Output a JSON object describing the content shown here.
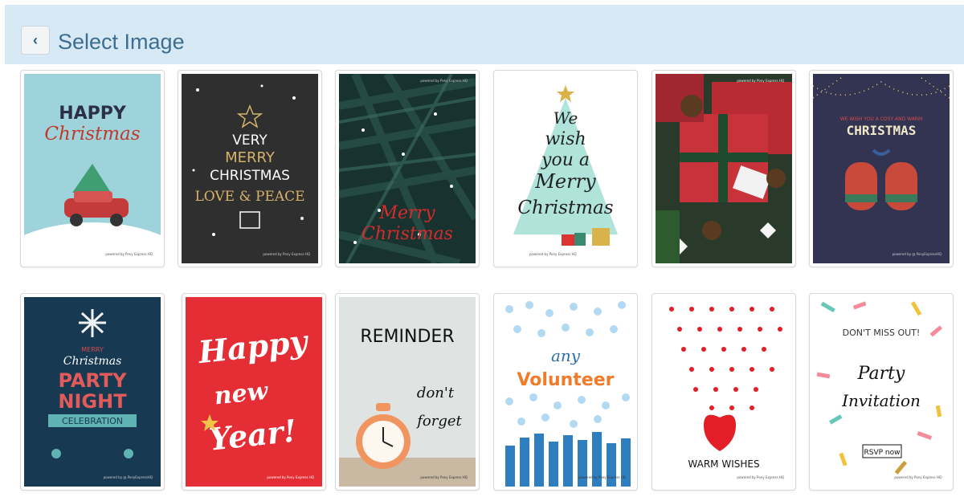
{
  "header": {
    "title": "Select Image",
    "back_icon": "chevron-left-icon"
  },
  "cards": [
    {
      "name": "happy-christmas-car",
      "lines": [
        "HAPPY",
        "Christmas"
      ],
      "footer": "powered by Pony Express HQ"
    },
    {
      "name": "very-merry-christmas",
      "lines": [
        "VERY",
        "MERRY",
        "CHRISTMAS",
        "LOVE & PEACE"
      ],
      "footer": "powered by Pony Express HQ"
    },
    {
      "name": "merry-christmas-pine",
      "lines": [
        "Merry",
        "Christmas"
      ],
      "footer": "powered by Pony Express HQ"
    },
    {
      "name": "we-wish-tree",
      "lines": [
        "We",
        "wish",
        "you a",
        "Merry",
        "Christmas"
      ],
      "footer": "powered by Pony Express HQ"
    },
    {
      "name": "gift-boxes-photo",
      "lines": [],
      "footer": "powered by Pony Express HQ"
    },
    {
      "name": "cosy-christmas-mittens",
      "lines": [
        "WE WISH YOU A COSY AND WARM",
        "CHRISTMAS"
      ],
      "footer": "powered by @ PonyExpressHQ"
    },
    {
      "name": "christmas-party-night",
      "lines": [
        "MERRY",
        "Christmas",
        "PARTY",
        "NIGHT",
        "CELEBRATION"
      ],
      "footer": "powered by @ PonyExpressHQ"
    },
    {
      "name": "happy-new-year",
      "lines": [
        "Happy",
        "new",
        "Year!"
      ],
      "footer": "powered by Pony Express HQ"
    },
    {
      "name": "reminder-clock",
      "lines": [
        "REMINDER",
        "don't",
        "forget"
      ],
      "footer": "powered by Pony Express HQ"
    },
    {
      "name": "any-volunteer",
      "lines": [
        "any",
        "Volunteer"
      ],
      "footer": "powered by Pony Express HQ"
    },
    {
      "name": "warm-wishes-hearts",
      "lines": [
        "WARM WISHES"
      ],
      "footer": "powered by Pony Express HQ"
    },
    {
      "name": "party-invitation",
      "lines": [
        "DON'T MISS OUT!",
        "Party",
        "Invitation",
        "RSVP now"
      ],
      "footer": "powered by Pony Express HQ"
    }
  ]
}
